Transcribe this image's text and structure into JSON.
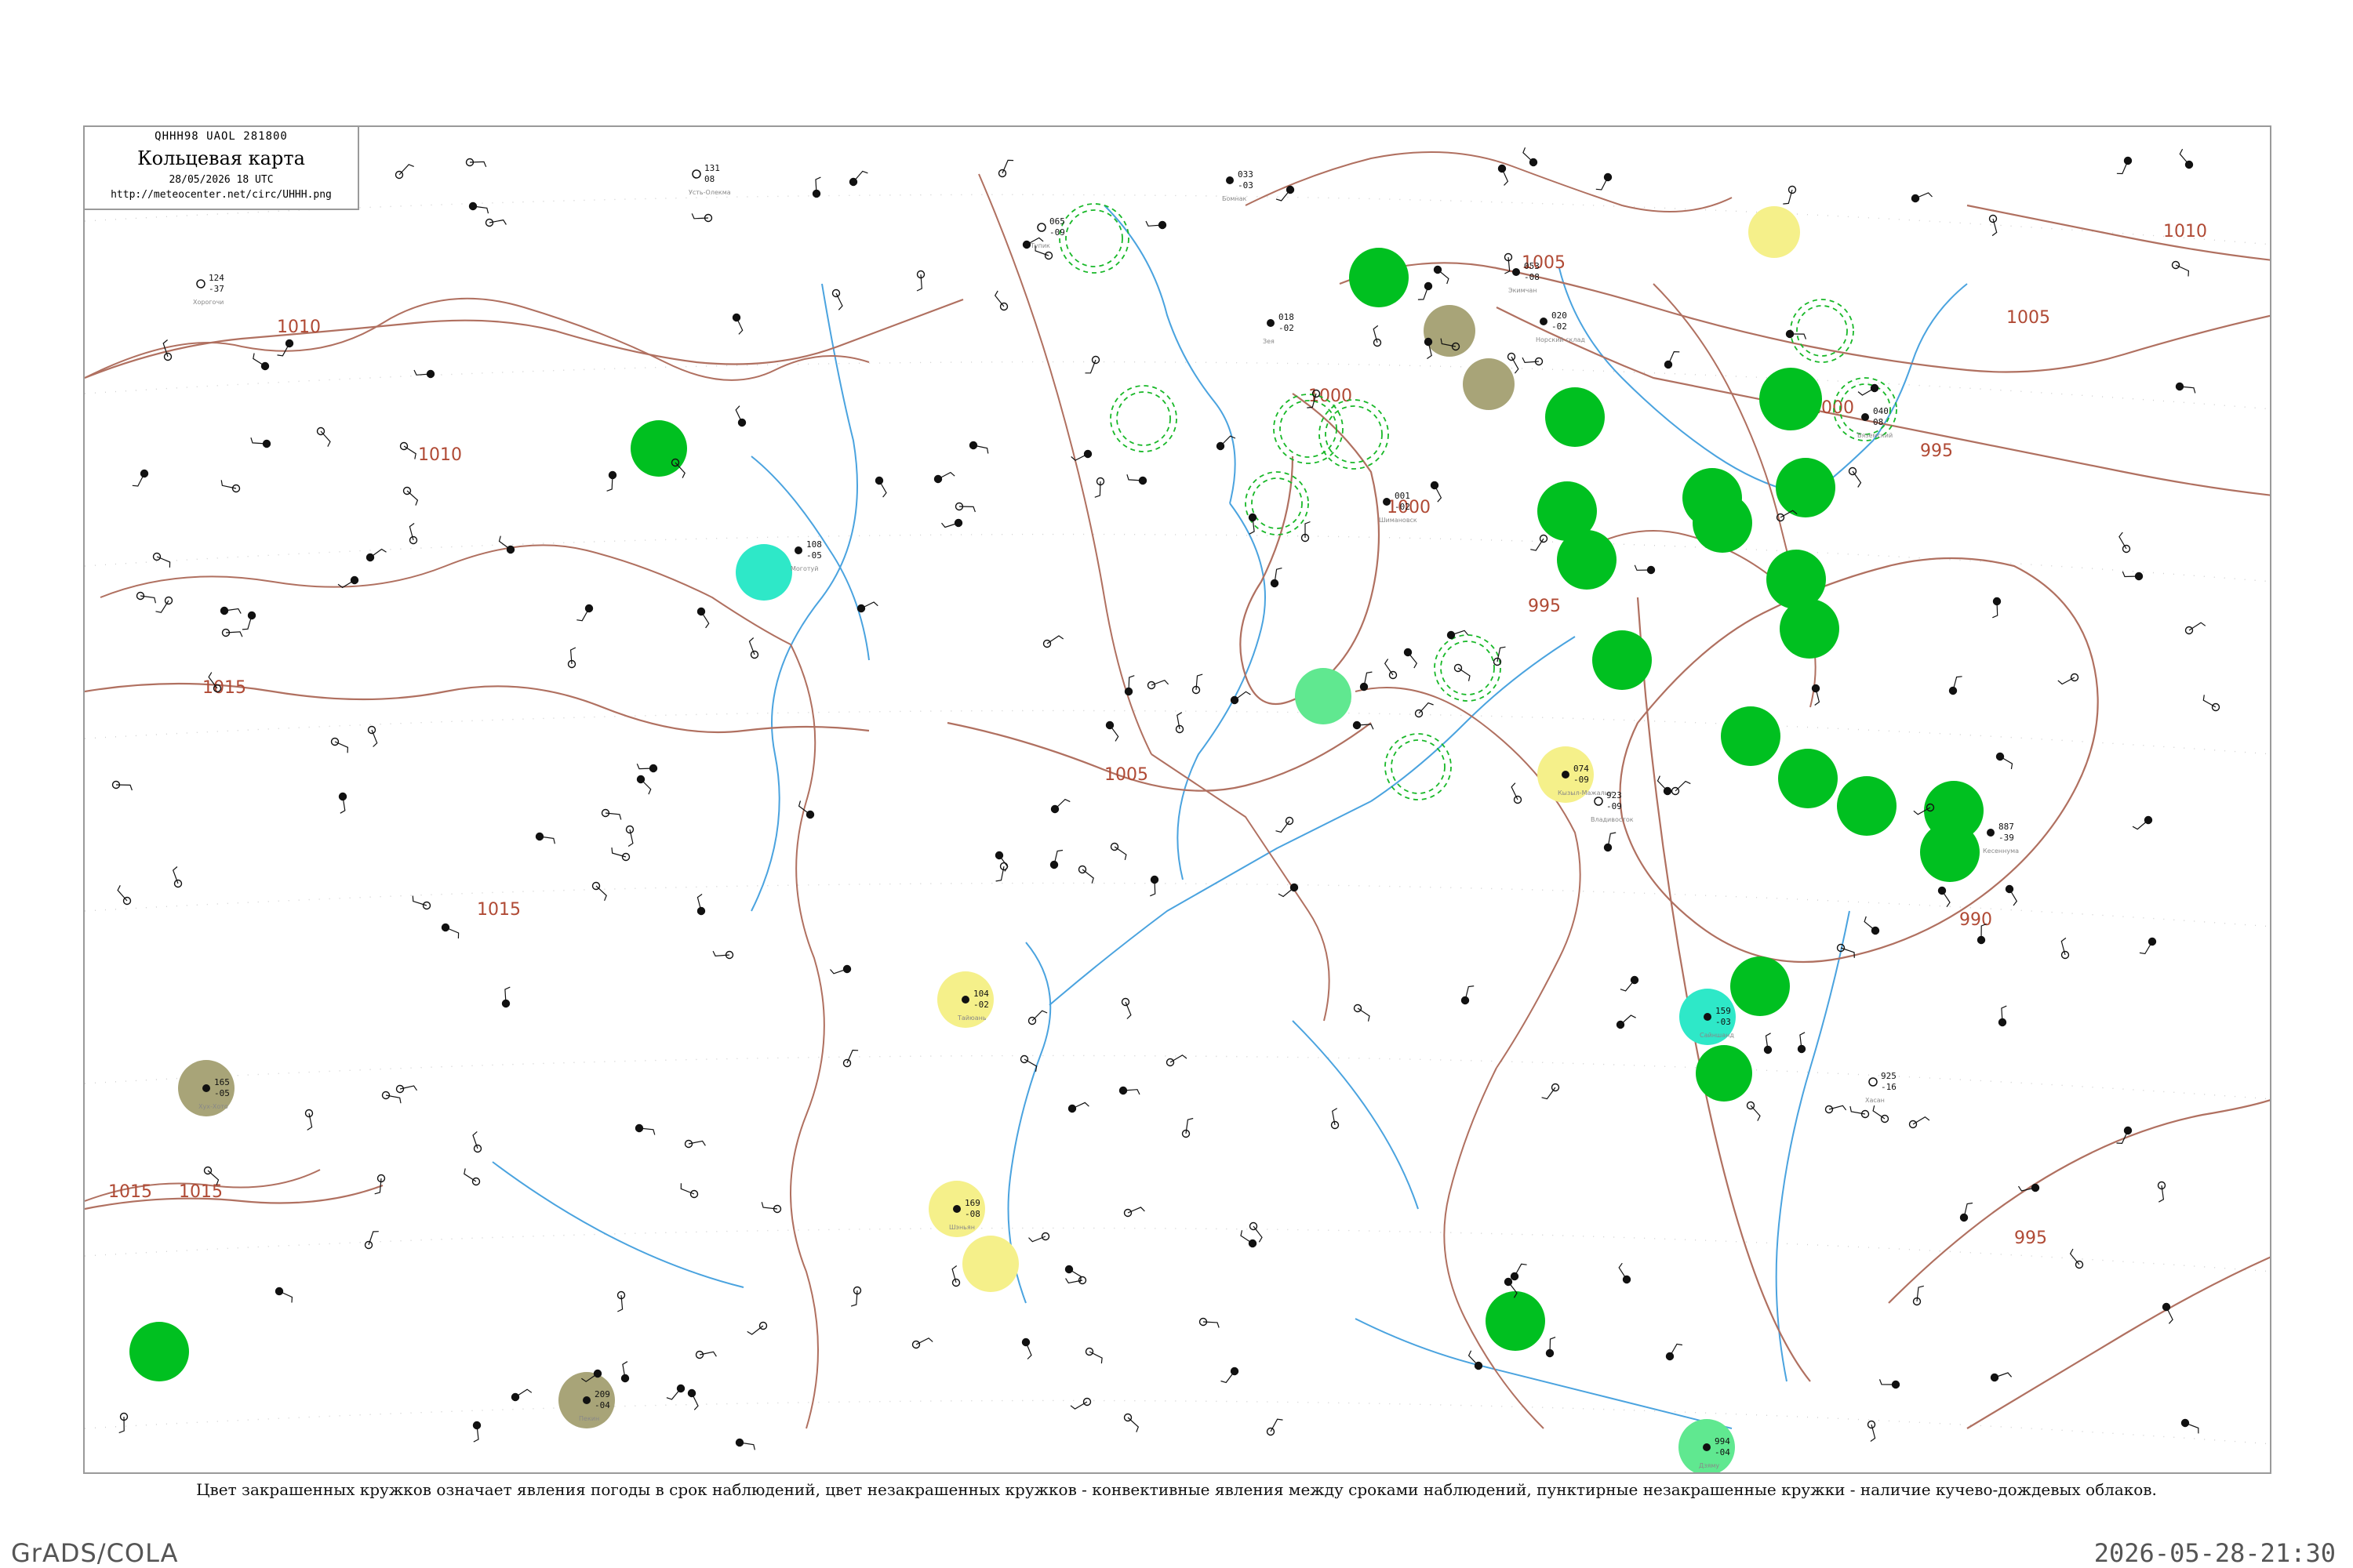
{
  "header": {
    "code": "QHHH98  UAOL  281800",
    "title": "Кольцевая карта",
    "date": "28/05/2026 18 UTC",
    "url": "http://meteocenter.net/circ/UHHH.png"
  },
  "caption": "Цвет закрашенных кружков означает явления погоды в срок наблюдений, цвет незакрашенных кружков - конвективные явления между сроками наблюдений, пунктирные незакрашенные кружки - наличие кучево-дождевых облаков.",
  "footer": {
    "software": "GrADS/COLA",
    "timestamp": "2026-05-28-21:30"
  },
  "colors": {
    "isobar": "#b07060",
    "isobar_label": "#b04a35",
    "river": "#4aa3df",
    "rain": "#00c020",
    "shower": "#18b828",
    "fog": "#f5f08a",
    "haze": "#a8a478",
    "drizzle": "#2ee8c8",
    "lightgreen": "#60e890",
    "frame": "#9a9a9a"
  },
  "isobar_labels": [
    "1010",
    "1010",
    "1015",
    "1015",
    "1015",
    "1015",
    "1005",
    "1000",
    "1000",
    "1000",
    "1005",
    "1010",
    "1005",
    "1000",
    "995",
    "995",
    "990",
    "995",
    "1010"
  ],
  "stations": [
    {
      "t": "124",
      "p": "-37",
      "id": "50915",
      "name": "Хорогочи"
    },
    {
      "t": "108",
      "p": "-05",
      "id": "50727",
      "name": "Моготуй"
    },
    {
      "t": "131",
      "p": "08",
      "id": "50603",
      "name": "Усть-Олекма"
    },
    {
      "t": "065",
      "p": "-09",
      "id": "30695",
      "name": "Тупик"
    },
    {
      "t": "033",
      "p": "-03",
      "id": "31253",
      "name": "Бомнак"
    },
    {
      "t": "001",
      "p": "-02",
      "id": "31174",
      "name": "Шимановск"
    },
    {
      "t": "053",
      "p": "-08",
      "id": "31418",
      "name": "Экимчан"
    },
    {
      "t": "020",
      "p": "-02",
      "id": "31416",
      "name": "Норский склад"
    },
    {
      "t": "018",
      "p": "-02",
      "id": "31297",
      "name": "Зея"
    },
    {
      "t": "040",
      "p": "08",
      "id": "31681",
      "name": "Вяземский"
    },
    {
      "t": "925",
      "p": "-16",
      "id": "47512",
      "name": "Хасан"
    },
    {
      "t": "994",
      "p": "-04",
      "id": "47698",
      "name": "Дзяму"
    },
    {
      "t": "159",
      "p": "-03",
      "id": "44878",
      "name": "Сайншанд"
    },
    {
      "t": "165",
      "p": "-05",
      "id": "53463",
      "name": "Хух-Хото"
    },
    {
      "t": "209",
      "p": "-04",
      "id": "54511",
      "name": "Пекин"
    },
    {
      "t": "169",
      "p": "-08",
      "id": "54342",
      "name": "Шэньян"
    },
    {
      "t": "104",
      "p": "-02",
      "id": "53772",
      "name": "Тайюань"
    },
    {
      "t": "074",
      "p": "-09",
      "id": "31770",
      "name": "Кызыл-Мажалык"
    },
    {
      "t": "923",
      "p": "-09",
      "id": "31989",
      "name": "Владивосток"
    },
    {
      "t": "887",
      "p": "-39",
      "id": "47420",
      "name": "Кесеннума"
    }
  ],
  "legend_note": "UHHH"
}
